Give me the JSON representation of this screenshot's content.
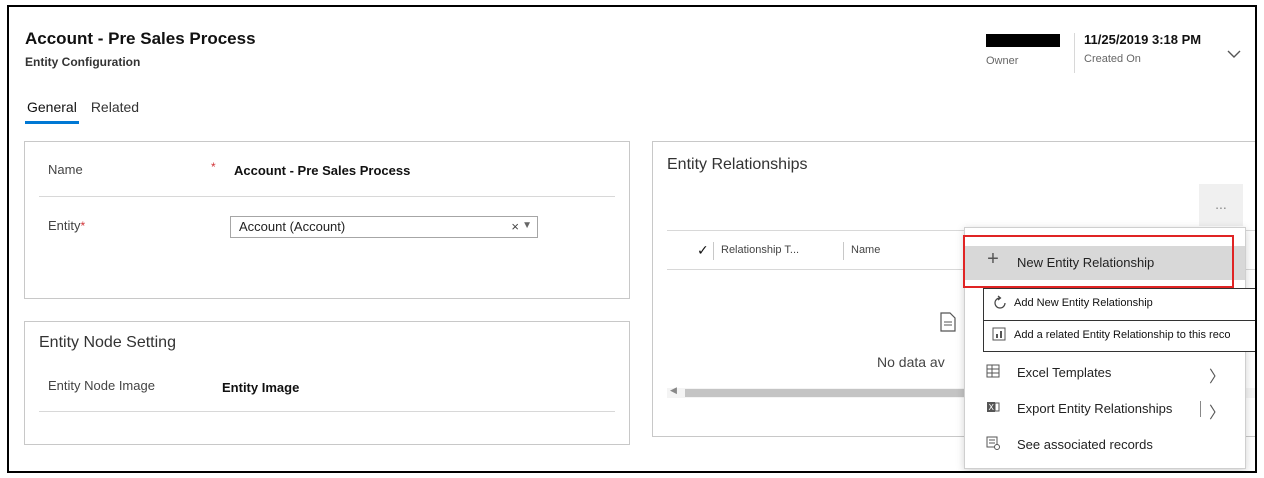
{
  "header": {
    "title": "Account - Pre Sales Process",
    "subtitle": "Entity Configuration",
    "owner_label": "Owner",
    "created_value": "11/25/2019 3:18 PM",
    "created_label": "Created On"
  },
  "tabs": [
    {
      "label": "General",
      "active": true
    },
    {
      "label": "Related",
      "active": false
    }
  ],
  "general": {
    "name_label": "Name",
    "required_marker": "*",
    "name_value": "Account - Pre Sales Process",
    "entity_label": "Entity",
    "entity_value": "Account (Account)",
    "clear_glyph": "×",
    "dropdown_glyph": "▼"
  },
  "node_setting": {
    "heading": "Entity Node Setting",
    "image_label": "Entity Node Image",
    "image_value": "Entity Image"
  },
  "relationships": {
    "heading": "Entity Relationships",
    "more_label": "...",
    "check_glyph": "✓",
    "columns": [
      "Relationship T...",
      "Name"
    ],
    "empty_text": "No data av"
  },
  "menu": {
    "items": [
      {
        "label": "New Entity Relationship",
        "icon": "plus-icon"
      },
      {
        "label": "Excel Templates",
        "icon": "excel-icon"
      },
      {
        "label": "Export Entity Relationships",
        "icon": "export-excel-icon"
      },
      {
        "label": "See associated records",
        "icon": "associated-records-icon"
      }
    ],
    "flyout": [
      {
        "label": "Add New Entity Relationship",
        "icon": "refresh-icon"
      },
      {
        "label": "Add a related Entity Relationship to this reco",
        "icon": "add-related-icon"
      }
    ],
    "chevron_glyph": "〉"
  },
  "colors": {
    "accent": "#0078d4",
    "required": "#d13438",
    "highlight_box": "#e02424"
  }
}
